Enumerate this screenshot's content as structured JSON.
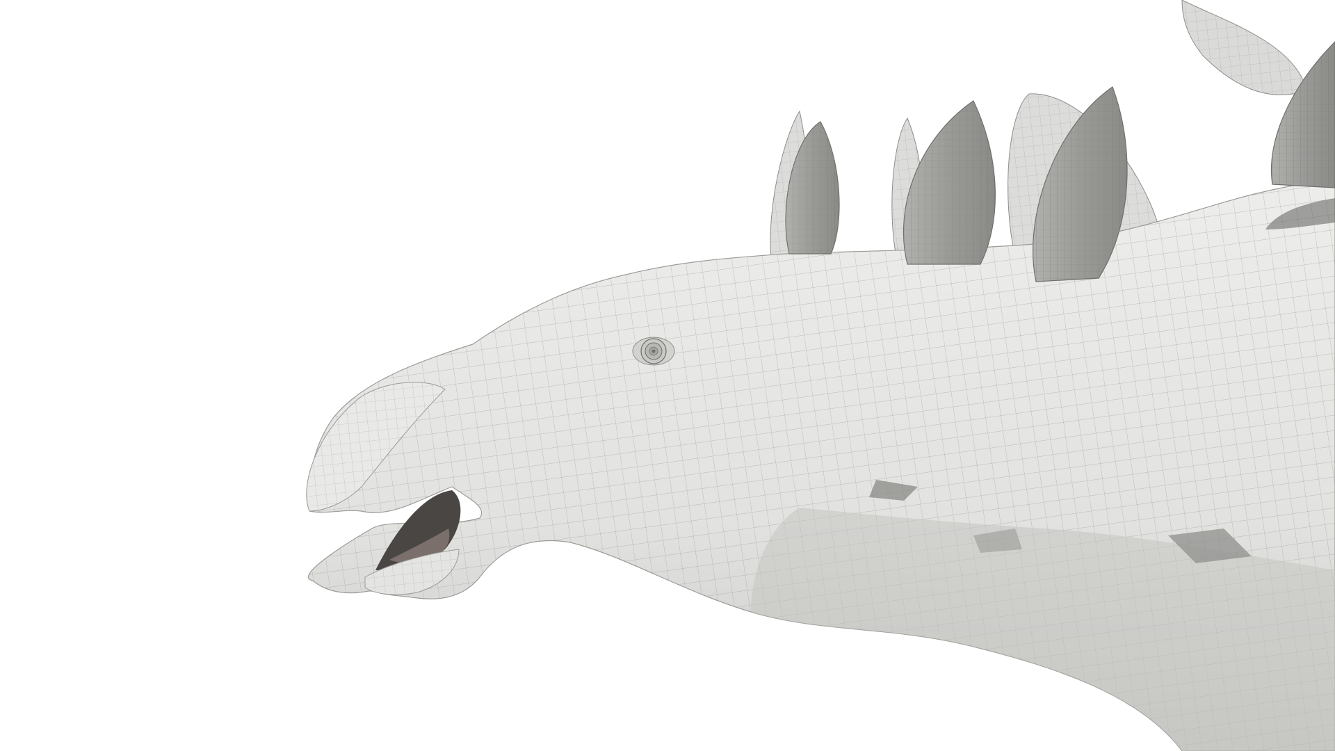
{
  "scene": {
    "subject": "stegosaurus-head-wireframe-render",
    "background_color": "#ffffff",
    "skin_color": "#e7e7e5",
    "skin_shadow_color": "#bdbdba",
    "plate_color": "#9a9a97",
    "plate_back_color": "#d6d6d4",
    "wire_color": "#8d8d8b",
    "mouth_color": "#4a4644"
  }
}
